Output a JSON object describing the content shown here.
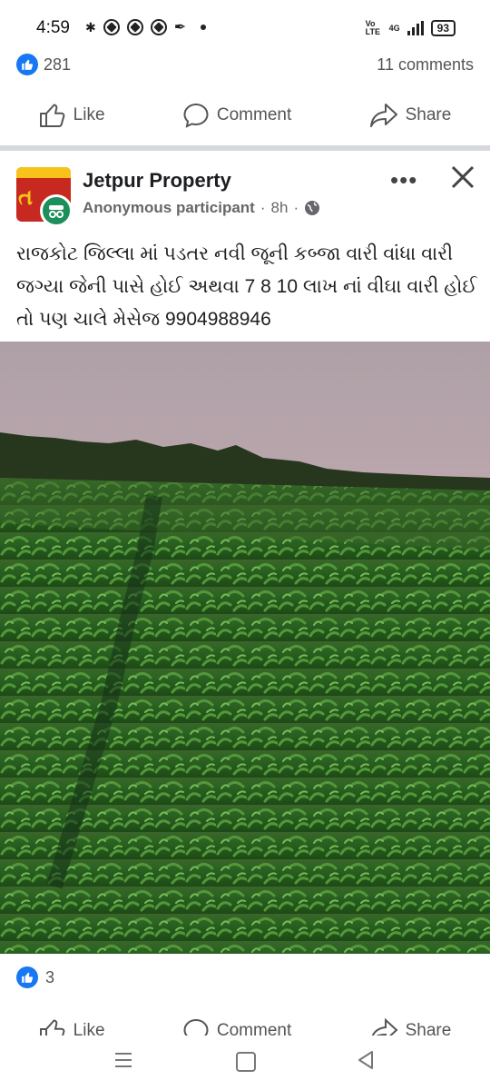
{
  "status_bar": {
    "time": "4:59",
    "network": "4G",
    "volte": "Vo LTE",
    "battery": "93"
  },
  "previous_post": {
    "like_count": "281",
    "comments_count": "11 comments"
  },
  "actions": {
    "like": "Like",
    "comment": "Comment",
    "share": "Share"
  },
  "post": {
    "group_name": "Jetpur Property",
    "author": "Anonymous participant",
    "time": "8h",
    "text": "રાજકોટ જિલ્લા માં પડતર નવી જૂની કબ્જા વારી વાંધા વારી જગ્યા જેની પાસે હોઈ અથવા 7 8 10 લાખ નાં વીઘા વારી હોઈ તો પણ ચાલે મેસેજ 9904988946",
    "like_count": "3"
  },
  "colors": {
    "brand_blue": "#1877f2",
    "muted_text": "#65676b",
    "avatar_red": "#c7281f",
    "avatar_green": "#1d8f5a"
  }
}
